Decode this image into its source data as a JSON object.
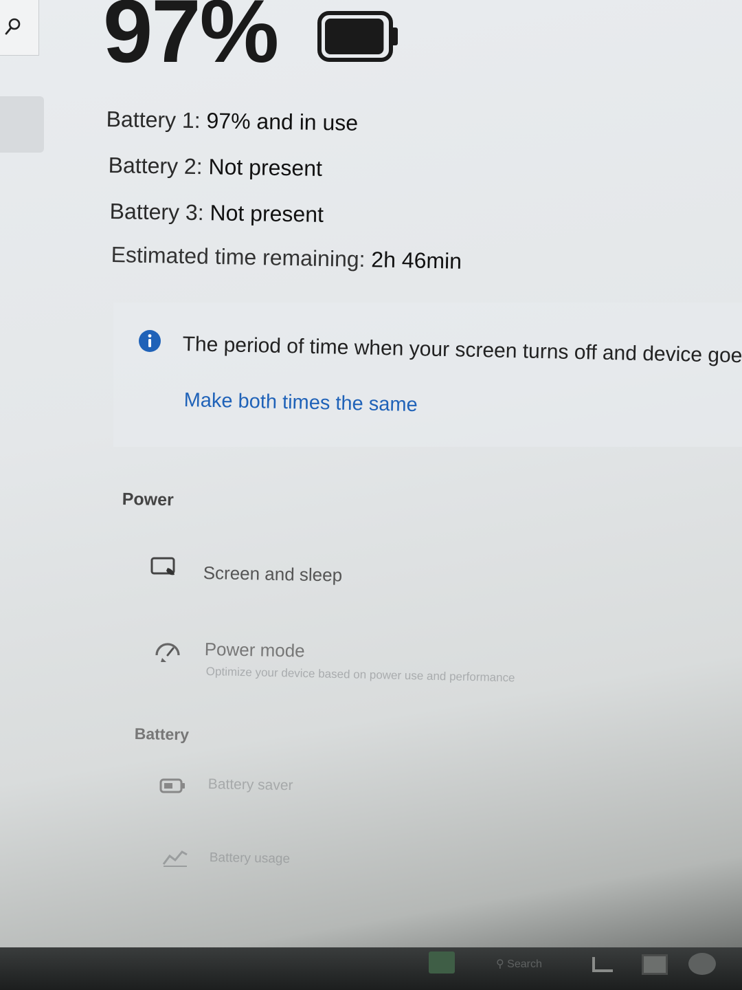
{
  "search": {
    "icon": "search-icon"
  },
  "summary": {
    "percent": "97%",
    "level": 0.97,
    "icon": "battery-icon"
  },
  "batteries": [
    {
      "label": "Battery 1:",
      "value": "97% and in use"
    },
    {
      "label": "Battery 2:",
      "value": "Not present"
    },
    {
      "label": "Battery 3:",
      "value": "Not present"
    }
  ],
  "estimate": {
    "label": "Estimated time remaining:",
    "value": "2h 46min"
  },
  "notice": {
    "text": "The period of time when your screen turns off and device goe",
    "link": "Make both times the same",
    "icon": "info-icon",
    "accent": "#1f62b8"
  },
  "power": {
    "heading": "Power",
    "items": [
      {
        "title": "Screen and sleep",
        "description": "",
        "icon": "monitor-icon"
      },
      {
        "title": "Power mode",
        "description": "Optimize your device based on power use and performance",
        "icon": "gauge-icon"
      }
    ]
  },
  "battery_section": {
    "heading": "Battery",
    "items": [
      {
        "title": "Battery saver",
        "icon": "battery-saver-icon"
      },
      {
        "title": "Battery usage",
        "icon": "chart-icon"
      }
    ]
  },
  "taskbar": {
    "search_label": "Search",
    "icons": [
      "windows-start-icon",
      "search-icon",
      "file-explorer-icon",
      "store-icon",
      "chat-icon"
    ]
  }
}
